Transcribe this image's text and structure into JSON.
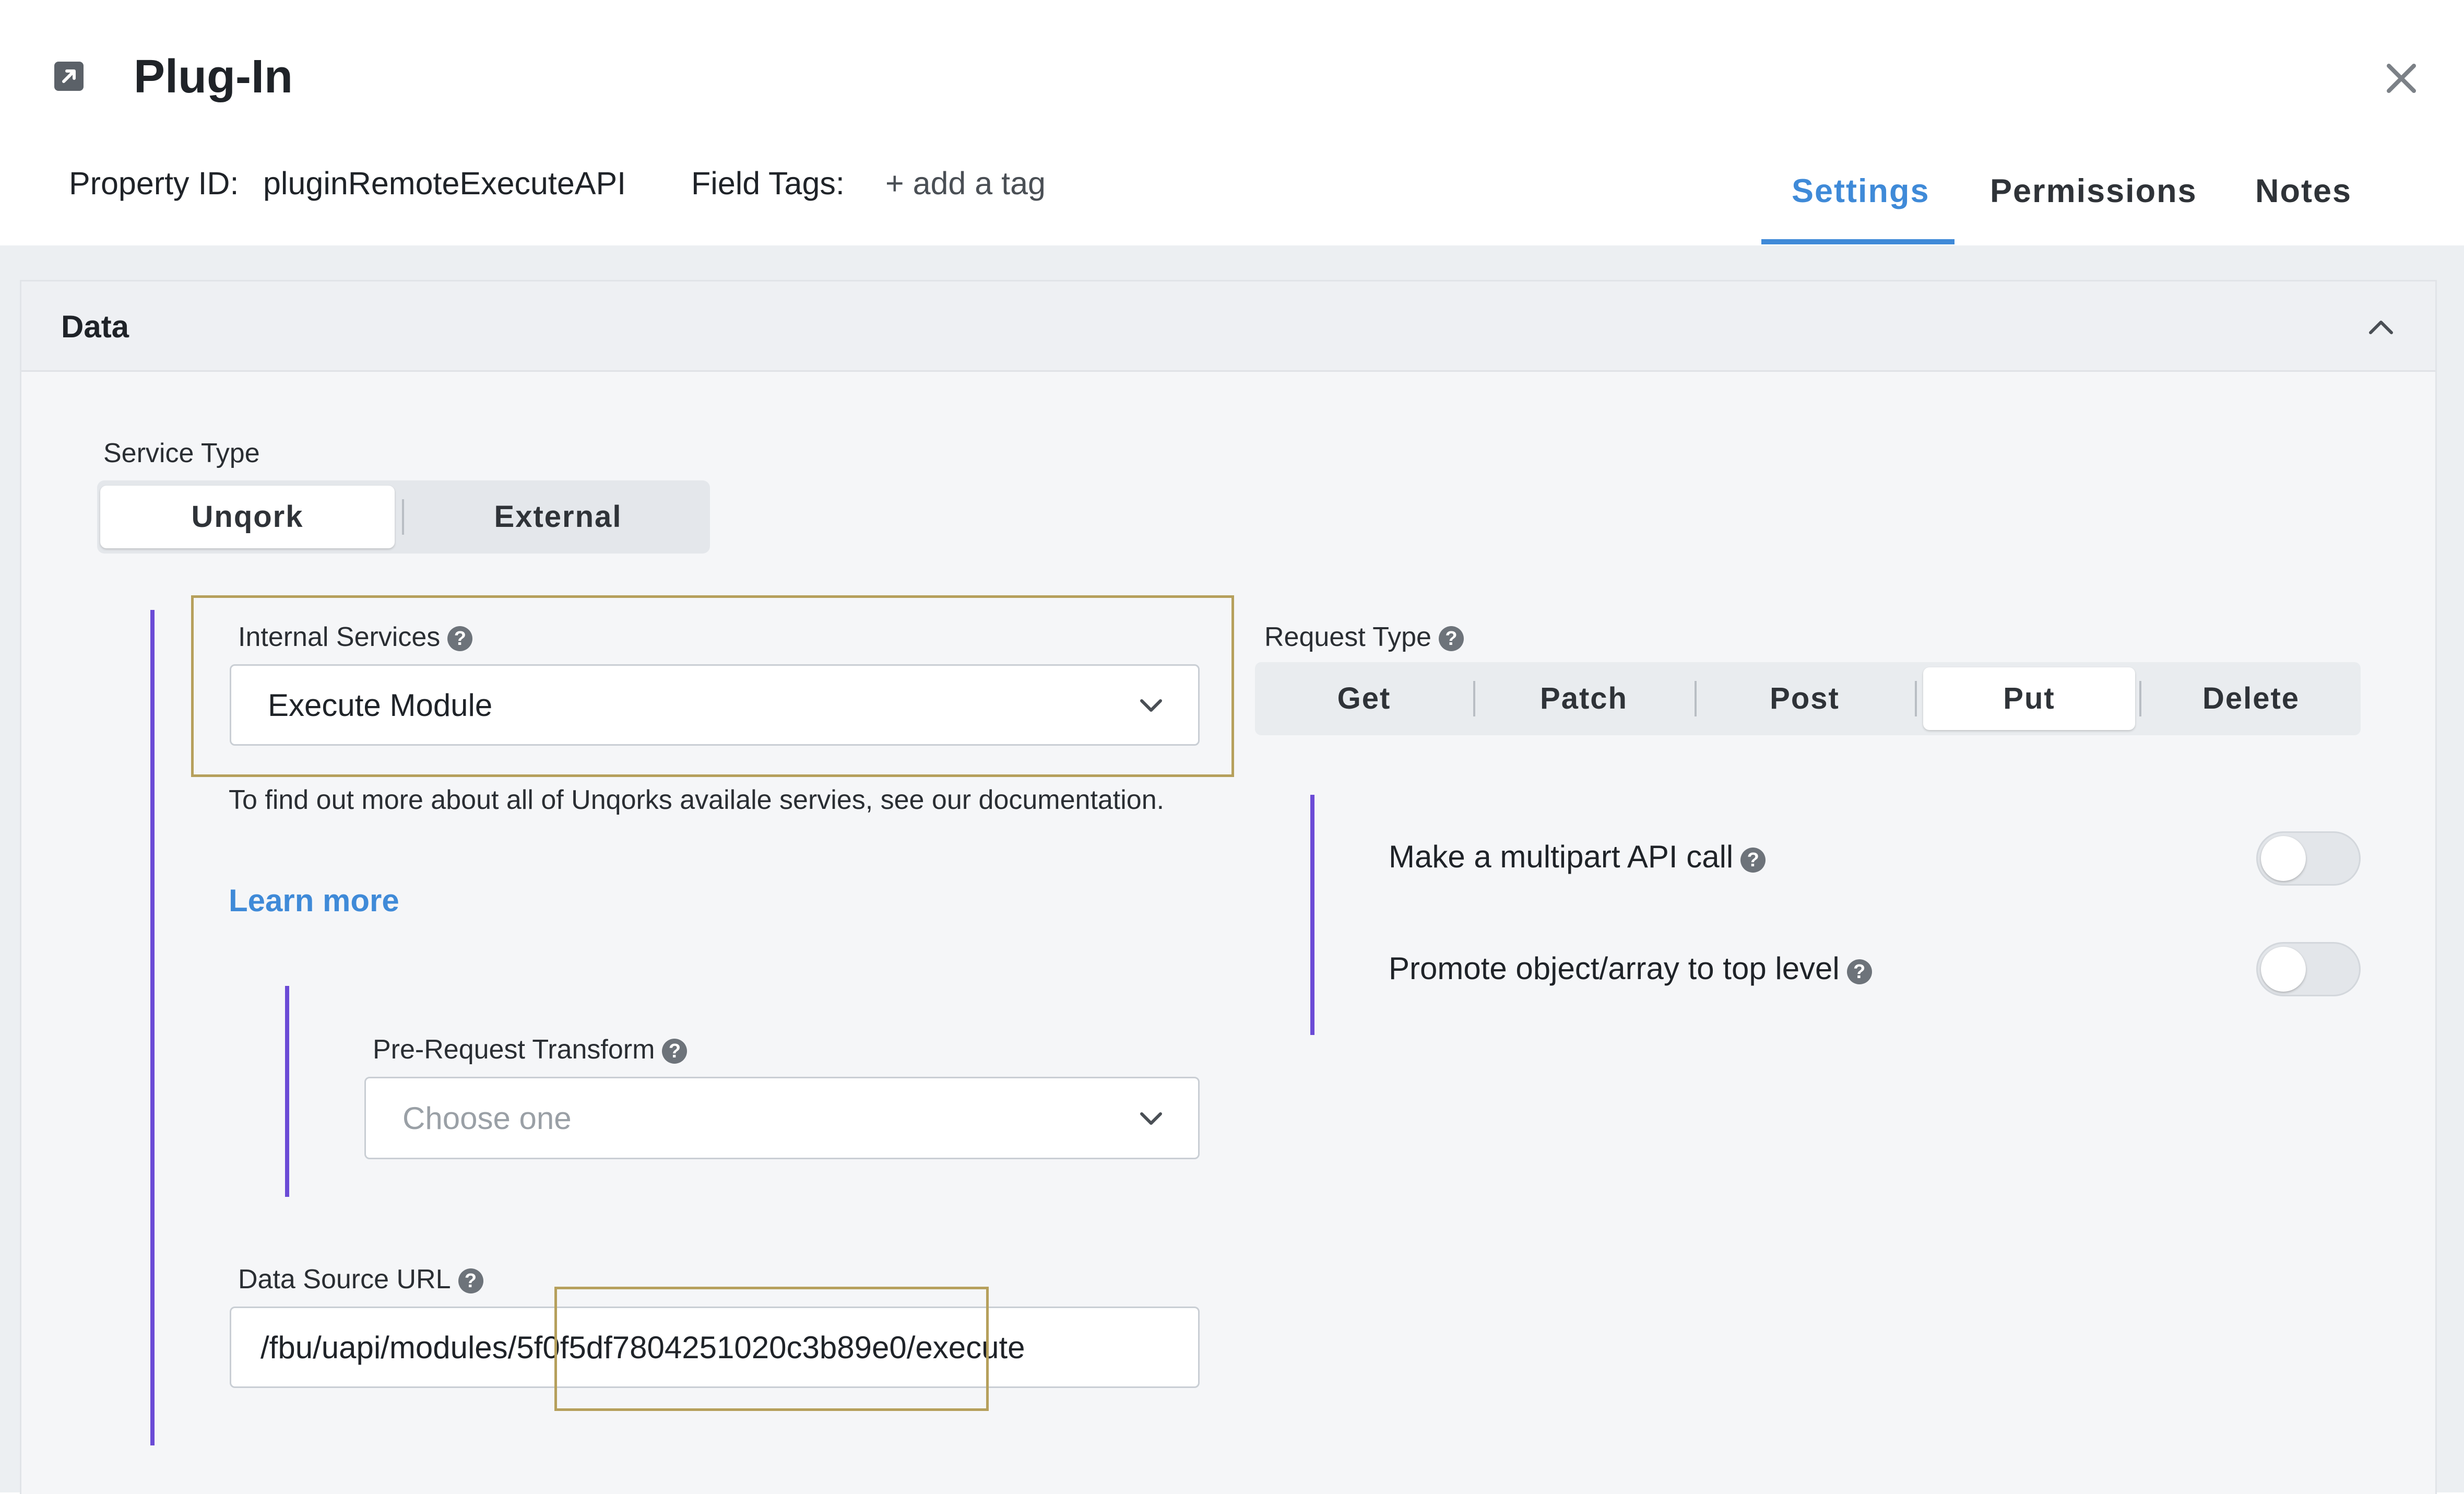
{
  "header": {
    "title": "Plug-In",
    "icon": "external-link-icon",
    "property_id_label": "Property ID:",
    "property_id_value": "pluginRemoteExecuteAPI",
    "field_tags_label": "Field Tags:",
    "add_tag": "+ add a tag",
    "close_icon": "close-icon"
  },
  "tabs": [
    {
      "label": "Settings",
      "active": true
    },
    {
      "label": "Permissions",
      "active": false
    },
    {
      "label": "Notes",
      "active": false
    }
  ],
  "panel": {
    "title": "Data",
    "collapse_icon": "chevron-up-icon"
  },
  "service_type": {
    "label": "Service Type",
    "options": [
      "Unqork",
      "External"
    ],
    "selected": "Unqork"
  },
  "internal_services": {
    "label": "Internal Services",
    "value": "Execute Module",
    "help_glyph": "?",
    "description": "To find out more about all of Unqorks availale servies, see our documentation.",
    "learn_more": "Learn more"
  },
  "pre_request_transform": {
    "label": "Pre-Request Transform",
    "placeholder": "Choose one"
  },
  "data_source_url": {
    "label": "Data Source URL",
    "value": "/fbu/uapi/modules/5f0f5df7804251020c3b89e0/execute"
  },
  "request_type": {
    "label": "Request Type",
    "options": [
      "Get",
      "Patch",
      "Post",
      "Put",
      "Delete"
    ],
    "selected": "Put"
  },
  "options": {
    "multipart_label": "Make a multipart API call",
    "multipart_on": false,
    "promote_label": "Promote object/array to top level",
    "promote_on": false
  },
  "colors": {
    "accent": "#3f8ad8",
    "purple_rule": "#6b4bd6",
    "highlight_box": "#b6a05c"
  }
}
